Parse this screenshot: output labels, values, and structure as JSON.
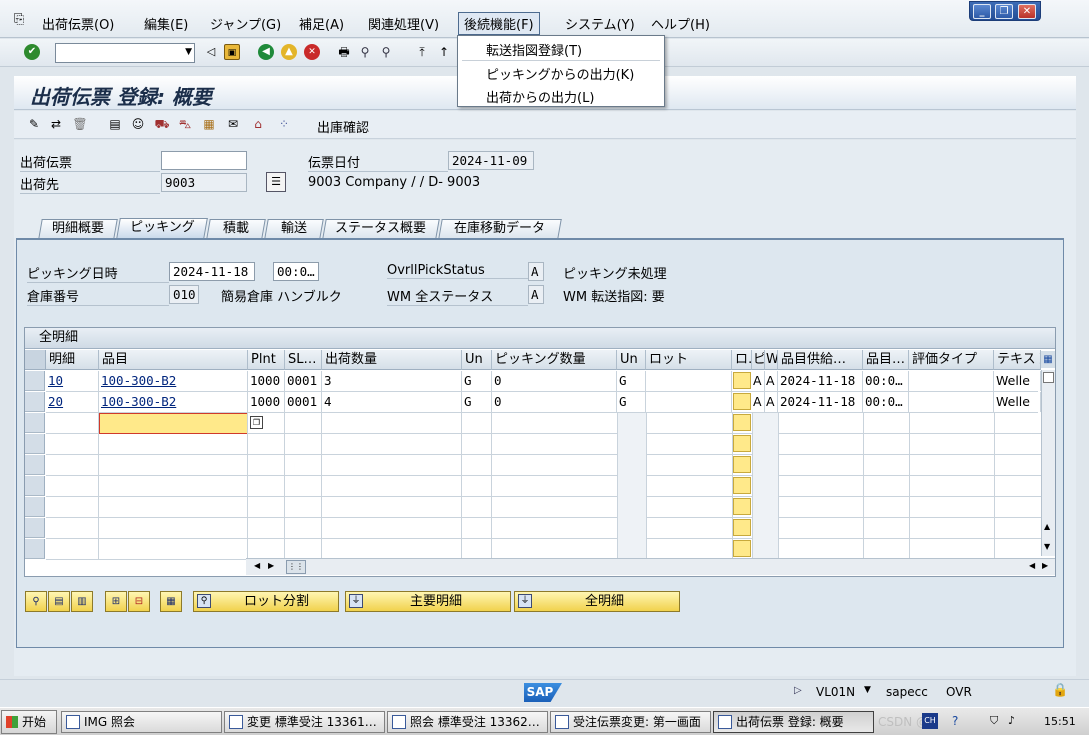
{
  "menubar": {
    "items": [
      "出荷伝票(O)",
      "編集(E)",
      "ジャンプ(G)",
      "補足(A)",
      "関連処理(V)",
      "後続機能(F)",
      "システム(Y)",
      "ヘルプ(H)"
    ],
    "active_index": 5
  },
  "window_controls": {
    "minimize": "_",
    "restore": "❐",
    "close": "✕"
  },
  "dropdown": {
    "items": [
      "転送指図登録(T)",
      "ピッキングからの出力(K)",
      "出荷からの出力(L)"
    ]
  },
  "title": "出荷伝票 登録: 概要",
  "apptoolbar": {
    "confirm_label": "出庫確認"
  },
  "header": {
    "delivery_label": "出荷伝票",
    "delivery_value": "",
    "doc_date_label": "伝票日付",
    "doc_date_value": "2024-11-09",
    "ship_to_label": "出荷先",
    "ship_to_value": "9003",
    "ship_to_desc": "9003 Company / / D- 9003"
  },
  "tabs": [
    "明細概要",
    "ピッキング",
    "積載",
    "輸送",
    "ステータス概要",
    "在庫移動データ"
  ],
  "active_tab": 1,
  "picking": {
    "date_label": "ピッキング日時",
    "date_value": "2024-11-18",
    "time_value": "00:0…",
    "ovrl_label": "OvrllPickStatus",
    "ovrl_value": "A",
    "ovrl_desc": "ピッキング未処理",
    "wh_label": "倉庫番号",
    "wh_value": "010",
    "wh_desc": "簡易倉庫 ハンブルク",
    "wm_label": "WM 全ステータス",
    "wm_value": "A",
    "wm_desc": "WM 転送指図: 要"
  },
  "table": {
    "title": "全明細",
    "columns": [
      "明細",
      "品目",
      "Plnt",
      "SL…",
      "出荷数量",
      "Un",
      "ピッキング数量",
      "Un",
      "ロット",
      "ロ…",
      "ピ",
      "W",
      "品目供給…",
      "品目…",
      "評価タイプ",
      "テキスト"
    ],
    "rows": [
      {
        "item": "10",
        "material": "100-300-B2",
        "plant": "1000",
        "sloc": "0001",
        "qty": "3",
        "un": "G",
        "pick_qty": "0",
        "un2": "G",
        "batch": "",
        "p": "A",
        "w": "A",
        "avail_date": "2024-11-18",
        "avail_time": "00:0…",
        "val_type": "",
        "text": "Welle"
      },
      {
        "item": "20",
        "material": "100-300-B2",
        "plant": "1000",
        "sloc": "0001",
        "qty": "4",
        "un": "G",
        "pick_qty": "0",
        "un2": "G",
        "batch": "",
        "p": "A",
        "w": "A",
        "avail_date": "2024-11-18",
        "avail_time": "00:0…",
        "val_type": "",
        "text": "Welle"
      }
    ]
  },
  "buttons": {
    "batch_split": "ロット分割",
    "main_items": "主要明細",
    "all_items": "全明細"
  },
  "statusbar": {
    "tcode": "VL01N",
    "server": "sapecc",
    "mode": "OVR",
    "sap_logo": "SAP"
  },
  "taskbar": {
    "start": "开始",
    "tasks": [
      "IMG 照会",
      "変更 標準受注 13361…",
      "照会 標準受注 13362…",
      "受注伝票変更: 第一画面",
      "出荷伝票 登録: 概要"
    ],
    "active_task": 4,
    "clock": "15:51",
    "watermark": "CSDN @"
  }
}
